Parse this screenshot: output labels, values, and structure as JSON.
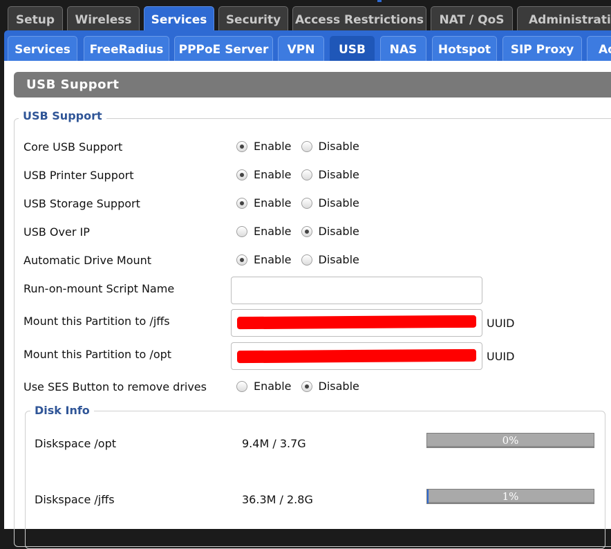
{
  "top_tabs": [
    {
      "label": "Setup"
    },
    {
      "label": "Wireless"
    },
    {
      "label": "Services",
      "active": true
    },
    {
      "label": "Security"
    },
    {
      "label": "Access Restrictions"
    },
    {
      "label": "NAT / QoS"
    },
    {
      "label": "Administration"
    }
  ],
  "sub_tabs": [
    {
      "label": "Services"
    },
    {
      "label": "FreeRadius"
    },
    {
      "label": "PPPoE Server"
    },
    {
      "label": "VPN"
    },
    {
      "label": "USB",
      "active": true
    },
    {
      "label": "NAS"
    },
    {
      "label": "Hotspot"
    },
    {
      "label": "SIP Proxy"
    },
    {
      "label": "Adblock"
    }
  ],
  "page": {
    "header": "USB Support",
    "legend": "USB Support",
    "radio_options": {
      "enable": "Enable",
      "disable": "Disable"
    },
    "rows": [
      {
        "label": "Core USB Support",
        "value": "enable"
      },
      {
        "label": "USB Printer Support",
        "value": "enable"
      },
      {
        "label": "USB Storage Support",
        "value": "enable"
      },
      {
        "label": "USB Over IP",
        "value": "disable"
      },
      {
        "label": "Automatic Drive Mount",
        "value": "enable"
      }
    ],
    "script_name": {
      "label": "Run-on-mount Script Name",
      "value": ""
    },
    "jffs_partition": {
      "label": "Mount this Partition to /jffs",
      "suffix": "UUID"
    },
    "opt_partition": {
      "label": "Mount this Partition to /opt",
      "suffix": "UUID"
    },
    "ses_button": {
      "label": "Use SES Button to remove drives",
      "value": "disable"
    }
  },
  "disk_info": {
    "legend": "Disk Info",
    "items": [
      {
        "label": "Diskspace /opt",
        "usage": "9.4M / 3.7G",
        "percent_text": "0%",
        "percent": 0
      },
      {
        "label": "Diskspace /jffs",
        "usage": "36.3M / 2.8G",
        "percent_text": "1%",
        "percent": 1
      }
    ]
  },
  "colors": {
    "accent": "#2e6ad3",
    "header_bg": "#797979",
    "legend": "#2f5597",
    "redaction": "#ff0000"
  }
}
